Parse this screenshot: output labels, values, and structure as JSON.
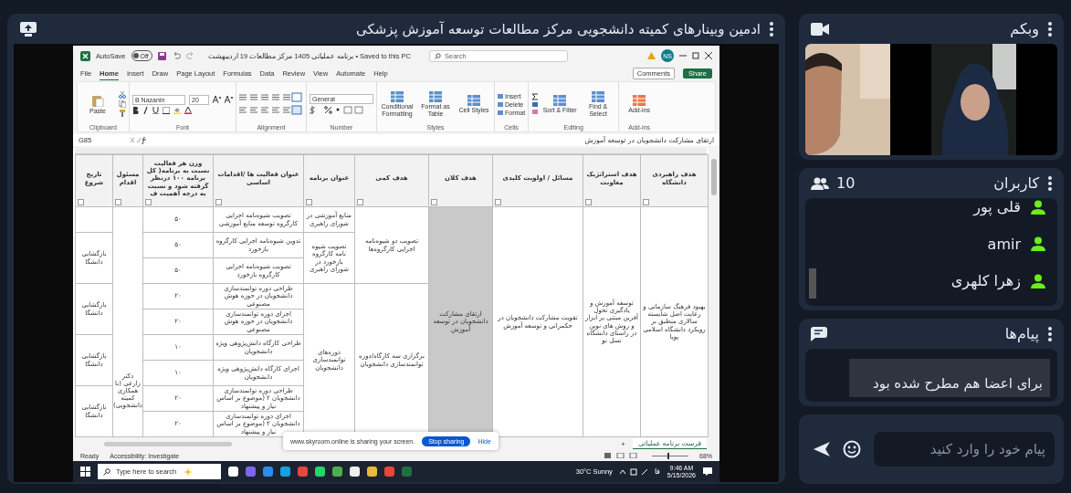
{
  "panel": {
    "title": "ادمین وبینارهای کمیته دانشجویی مرکز مطالعات توسعه آموزش پزشکی"
  },
  "excel": {
    "autosave": {
      "label": "AutoSave",
      "state": "Off",
      "on": false
    },
    "file_title": "برنامه عملیاتی 1405 مرکز مطالعات 19 اردیبهشت",
    "save_status": "• Saved to this PC",
    "search": {
      "placeholder": "Search"
    },
    "account": "NS",
    "tabs": [
      {
        "label": "Help",
        "selected": false
      },
      {
        "label": "Automate",
        "selected": false
      },
      {
        "label": "View",
        "selected": false
      },
      {
        "label": "Review",
        "selected": false
      },
      {
        "label": "Data",
        "selected": false
      },
      {
        "label": "Formulas",
        "selected": false
      },
      {
        "label": "Page Layout",
        "selected": false
      },
      {
        "label": "Draw",
        "selected": false
      },
      {
        "label": "Insert",
        "selected": false
      },
      {
        "label": "Home",
        "selected": true
      },
      {
        "label": "File",
        "selected": false
      }
    ],
    "comments": "Comments",
    "share": "Share",
    "ribbon": [
      {
        "kind": "addins",
        "label": "Add-ins",
        "commands": [
          "Add-ins"
        ]
      },
      {
        "kind": "editing",
        "label": "Editing",
        "commands": [
          "Find & Select",
          "Sort & Filter"
        ]
      },
      {
        "kind": "cells",
        "label": "Cells",
        "commands": [
          "Insert",
          "Delete",
          "Format"
        ]
      },
      {
        "kind": "styles",
        "label": "Styles",
        "commands": [
          "Cell Styles",
          "Format as Table",
          "Conditional Formatting"
        ]
      },
      {
        "kind": "number",
        "label": "Number",
        "format": "General"
      },
      {
        "kind": "alignment",
        "label": "Alignment"
      },
      {
        "kind": "font",
        "label": "Font",
        "font_name": "B Nazanin",
        "font_size": "20"
      },
      {
        "kind": "clipboard",
        "label": "Clipboard",
        "commands": [
          "Paste"
        ]
      }
    ],
    "name_box": "G85",
    "formula": "ارتقای مشارکت دانشجویان در توسعه آموزش",
    "columns": [
      "هدف راهبردی دانشگاه",
      "هدف استراتژیک معاونت",
      "مسائل / اولویت کلیدی",
      "هدف کلان",
      "هدف کمی",
      "عنوان برنامه",
      "عنوان فعالیت ها /اقدامات اساسی",
      "وزن هر فعالیت نسبت به برنامه( کل برنامه ۱۰۰ درنظر گرفته شود و نسبت به درجه اهمیت ف",
      "مسئول اقدام",
      "تاریخ شروع"
    ],
    "university_goal": "بهبود فرهنگ سازمانی و رعایت اصل شایسته سالاری منطبق بر رویکرد دانشگاه اسلامی پویا",
    "strategic_goal": "توسعه آموزش و یادگیری تحول آفرین مبتنی بر ابزار و روش های نوین در راستای دانشگاه نسل نو",
    "key_issue": "تقویت مشارکت دانشجویان در حکمرانی و توسعه آموزش",
    "macro_goal": "ارتقای مشارکت دانشجویان در توسعه آموزش",
    "quant_goals": [
      {
        "text": "تصویب دو شیوه‌نامه اجرایی کارگروه‌ها",
        "programs": [
          {
            "text": "منابع آموزشی در شورای راهبری",
            "activities": [
              {
                "title": "تصویب شیوه‌نامه اجرایی کارگروه توسعه منابع آموزشی",
                "weight": "۵۰"
              }
            ]
          },
          {
            "text": "تصویب شیوه نامه کارگروه بازخورد در شورای راهبری",
            "activities": [
              {
                "title": "تدوین شیوه‌نامه اجرایی کارگروه بازخورد",
                "weight": "۵۰"
              },
              {
                "title": "تصویب شیوه‌نامه اجرایی کارگروه بازخورد",
                "weight": "۵۰"
              }
            ]
          }
        ]
      },
      {
        "text": "برگزاری سه کارگاه/دوره توانمندسازی دانشجویان",
        "programs": [
          {
            "text": "دوره‌های توانمندسازی دانشجویان",
            "activities": [
              {
                "title": "طراحی دوره توانمندسازی دانشجویان در حوزه هوش مصنوعی",
                "weight": "۲۰"
              },
              {
                "title": "اجرای دوره توانمندسازی دانشجویان در حوزه هوش مصنوعی",
                "weight": "۲۰"
              },
              {
                "title": "طراحی کارگاه دانش‌پژوهی ویژه دانشجویان",
                "weight": "۱۰"
              },
              {
                "title": "اجرای کارگاه دانش‌پژوهی ویژه دانشجویان",
                "weight": "۱۰"
              },
              {
                "title": "طراحی دوره توانمندسازی دانشجویان ۲ (موضوع بر اساس نیاز و پیشنهاد",
                "weight": "۲۰"
              },
              {
                "title": "اجرای دوره توانمندسازی دانشجویان ۲ (موضوع بر اساس نیاز و پیشنهاد",
                "weight": "۲۰"
              }
            ]
          }
        ]
      }
    ],
    "responsible": "دکتر زارعی (با همکاری کمیته دانشجویی)",
    "start_dates": [
      "بازگشایی دانشگا",
      "بازگشایی دانشگا",
      "بازگشایی دانشگا",
      "بازگشایی دانشگا"
    ],
    "sheet_tab": {
      "label": "فرست برنامه عملیاتی",
      "selected": true
    },
    "add_sheet": "+",
    "status": "Ready",
    "accessibility": "Accessibility: Investigate",
    "zoom_slider": {
      "level": 0.42
    },
    "zoom": "68%",
    "share_banner": {
      "message": "www.skyroom.online is sharing your screen.",
      "stop": "Stop sharing",
      "hide": "Hide"
    },
    "taskbar": {
      "search_placeholder": "Type here to search",
      "weather": "30°C Sunny",
      "language": "فا",
      "time": "9:46 AM",
      "date": "5/15/2026"
    }
  },
  "webcam": {
    "title": "وبکم"
  },
  "users": {
    "title": "کاربران",
    "count": "10",
    "list": [
      {
        "name": "قلی پور"
      },
      {
        "name": "amir"
      },
      {
        "name": "زهرا کلهری"
      }
    ]
  },
  "messages": {
    "title": "پیام‌ها",
    "list": [
      {
        "text": "برای اعضا هم مطرح شده بود"
      }
    ]
  },
  "composer": {
    "placeholder": "پیام خود را وارد کنید"
  }
}
